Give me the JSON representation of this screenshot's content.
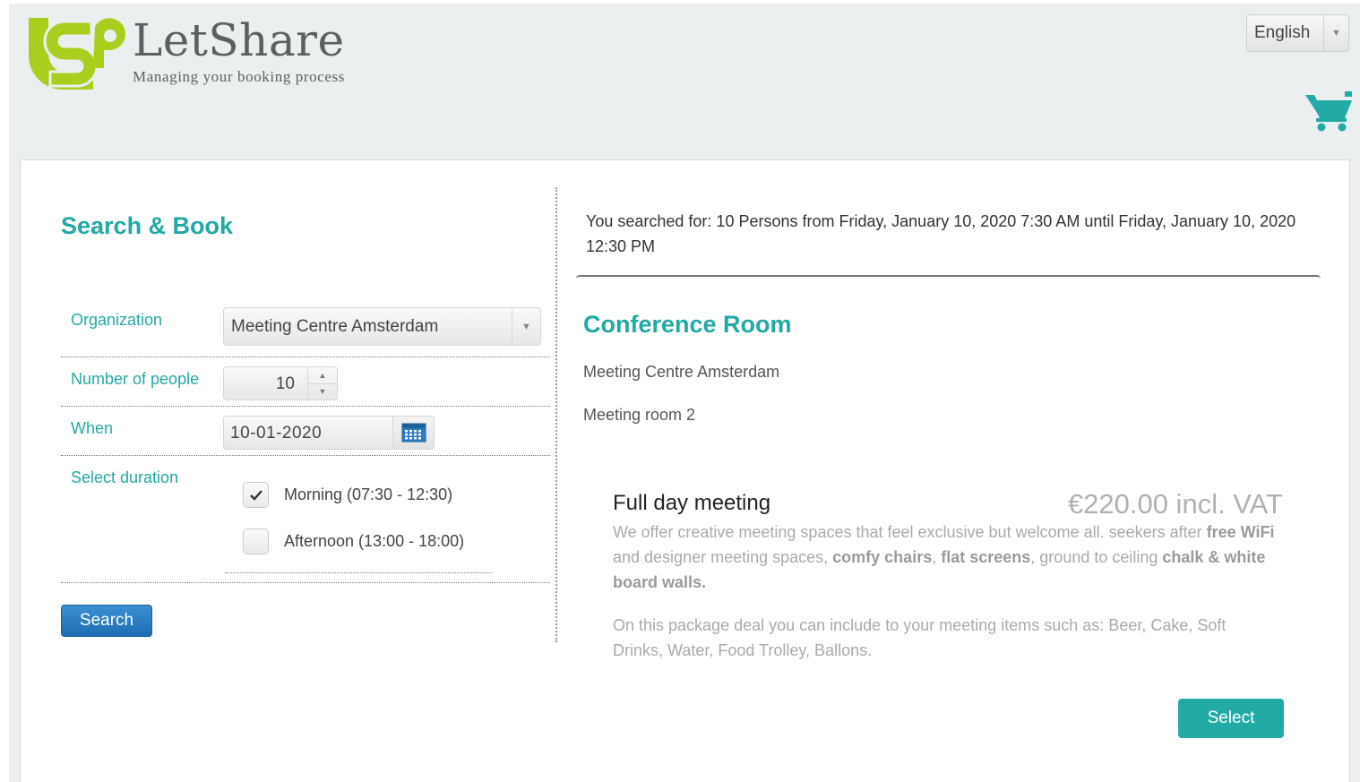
{
  "brand": {
    "name": "LetShare",
    "tagline": "Managing your booking process",
    "logo_color": "#a8cf1e",
    "accent_color": "#23a9a5"
  },
  "header": {
    "language": "English",
    "cart_icon": "cart-icon"
  },
  "search_form": {
    "title": "Search & Book",
    "organization": {
      "label": "Organization",
      "value": "Meeting Centre Amsterdam"
    },
    "people": {
      "label": "Number of people",
      "value": "10"
    },
    "when": {
      "label": "When",
      "value": "10-01-2020",
      "icon": "calendar-icon"
    },
    "duration": {
      "label": "Select duration",
      "options": [
        {
          "label": "Morning (07:30 - 12:30)",
          "checked": true
        },
        {
          "label": "Afternoon (13:00 - 18:00)",
          "checked": false
        }
      ]
    },
    "search_label": "Search"
  },
  "results": {
    "summary": "You searched for: 10 Persons from Friday, January 10, 2020 7:30 AM until Friday, January 10, 2020 12:30 PM",
    "room_title": "Conference Room",
    "organization": "Meeting Centre Amsterdam",
    "room": "Meeting room 2",
    "package": {
      "title": "Full day meeting",
      "price": "€220.00 incl. VAT",
      "desc_1": "We offer creative meeting spaces that feel exclusive but welcome all. seekers after ",
      "desc_b1": "free WiFi",
      "desc_2": " and designer meeting spaces, ",
      "desc_b2": "comfy chairs",
      "desc_3": ", ",
      "desc_b3": "flat screens",
      "desc_4": ", ground to ceiling ",
      "desc_b4": "chalk & white board walls.",
      "items": "On this package deal you can include to your meeting items such as: Beer, Cake, Soft Drinks, Water, Food Trolley, Ballons.",
      "select_label": "Select"
    }
  }
}
